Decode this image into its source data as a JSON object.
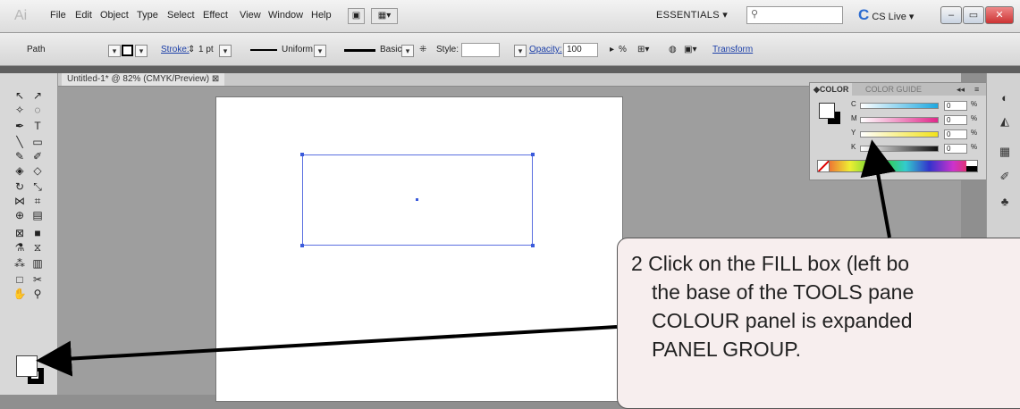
{
  "app": {
    "logo": "Ai"
  },
  "menubar": {
    "items": [
      "File",
      "Edit",
      "Object",
      "Type",
      "Select",
      "Effect",
      "View",
      "Window",
      "Help"
    ],
    "workspace": "ESSENTIALS ▾",
    "search_placeholder": "",
    "cslive": "CS Live ▾"
  },
  "control": {
    "selection_type": "Path",
    "stroke_label": "Stroke:",
    "stroke_weight": "1 pt",
    "profile_uniform": "Uniform",
    "brush_basic": "Basic",
    "style_label": "Style:",
    "opacity_label": "Opacity:",
    "opacity_value": "100",
    "percent": "%",
    "transform_link": "Transform"
  },
  "document": {
    "tab_title": "Untitled-1* @ 82% (CMYK/Preview)"
  },
  "color_panel": {
    "tab_color": "COLOR",
    "tab_guide": "COLOR GUIDE",
    "channels": [
      {
        "label": "C",
        "value": "0",
        "color": "#1ea8e0"
      },
      {
        "label": "M",
        "value": "0",
        "color": "#e0288a"
      },
      {
        "label": "Y",
        "value": "0",
        "color": "#f2e21a"
      },
      {
        "label": "K",
        "value": "0",
        "color": "#111111"
      }
    ],
    "percent_sign": "%"
  },
  "callout": {
    "lines": [
      "2  Click on the FILL box (left bo",
      "the base of the TOOLS pane",
      "COLOUR panel is expanded",
      "PANEL GROUP."
    ]
  }
}
